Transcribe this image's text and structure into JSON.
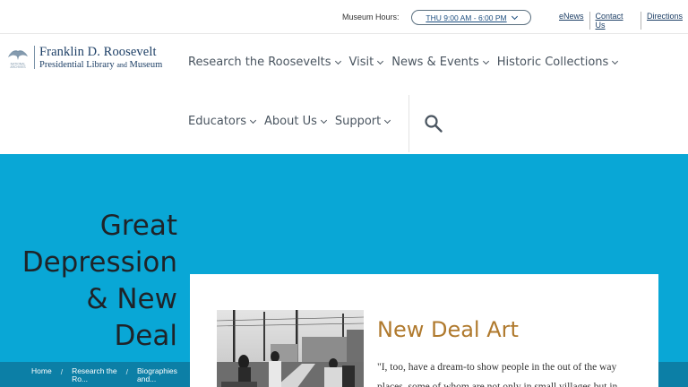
{
  "utility": {
    "hours_label": "Museum Hours:",
    "hours_value": "THU 9:00 AM - 6:00 PM",
    "links": [
      "eNews",
      "Contact Us",
      "Directions"
    ]
  },
  "logo": {
    "line1": "Franklin D. Roosevelt",
    "line2_a": "Presidential Library",
    "line2_b": "and",
    "line2_c": "Museum",
    "mark_text": "NATIONAL ARCHIVES"
  },
  "nav": {
    "row1": [
      "Research the Roosevelts",
      "Visit",
      "News & Events",
      "Historic Collections"
    ],
    "row2": [
      "Educators",
      "About Us",
      "Support"
    ]
  },
  "hero": {
    "title_lines": [
      "Great",
      "Depression",
      "& New",
      "Deal"
    ]
  },
  "breadcrumb": {
    "items": [
      {
        "line1": "Home",
        "line2": ""
      },
      {
        "line1": "Research the",
        "line2": "Ro..."
      },
      {
        "line1": "Biographies",
        "line2": "and..."
      }
    ]
  },
  "card": {
    "title": "New Deal Art",
    "text_line1": "\"I, too, have a dream-to show people in the out of the way",
    "text_line2": "places, some of whom are not only in small villages but in"
  },
  "colors": {
    "hero_bg": "#09a7d6",
    "breadcrumb_bg": "#0c7fa6",
    "title_accent": "#b07a2e",
    "brand_blue": "#1d3f66"
  }
}
